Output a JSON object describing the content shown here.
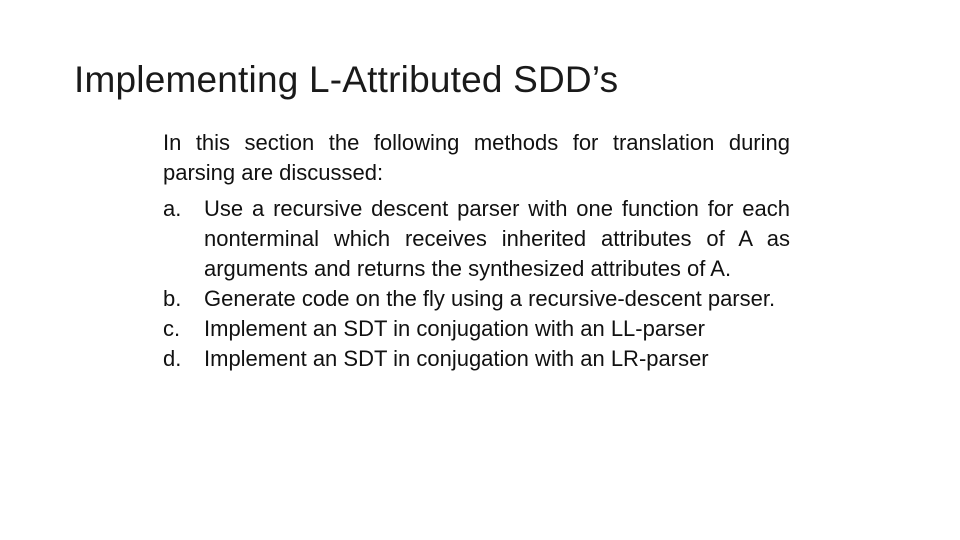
{
  "slide": {
    "title": "Implementing L-Attributed SDD’s",
    "intro": "In this section the following methods for translation during parsing are discussed:",
    "items": [
      {
        "marker": "a.",
        "text": "Use a recursive descent parser with one function for each nonterminal which receives inherited attributes of A as arguments and returns the synthesized attributes of A."
      },
      {
        "marker": "b.",
        "text": "Generate code on the fly using a recursive-descent parser."
      },
      {
        "marker": "c.",
        "text": "Implement an SDT in conjugation with an LL-parser"
      },
      {
        "marker": "d.",
        "text": "Implement an SDT in conjugation with an LR-parser"
      }
    ]
  }
}
